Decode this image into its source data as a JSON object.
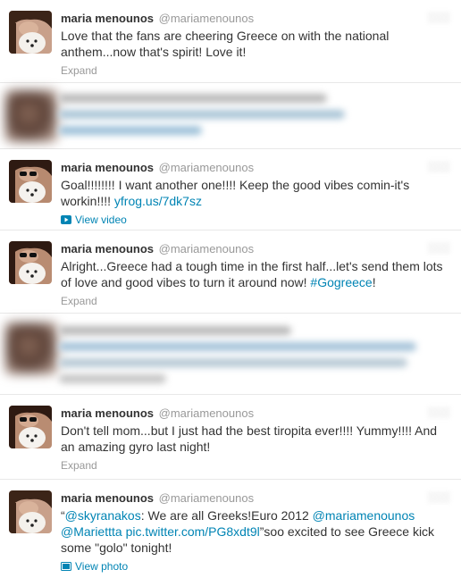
{
  "tweets": [
    {
      "fullname": "maria menounos",
      "username": "@mariamenounos",
      "text": "Love that the fans are cheering Greece on with the national anthem...now that's spirit! Love it!",
      "action": "Expand"
    },
    {
      "fullname": "maria menounos",
      "username": "@mariamenounos",
      "text_before": "Goal!!!!!!!! I want another one!!!! Keep the good vibes comin-it's workin!!!! ",
      "link": "yfrog.us/7dk7sz",
      "action": "View video",
      "action_icon": "video-icon"
    },
    {
      "fullname": "maria menounos",
      "username": "@mariamenounos",
      "text_before": "Alright...Greece had a tough time in the first half...let's send them lots of love and good vibes to turn it around now! ",
      "hashtag": "#Gogreece",
      "text_after": "!",
      "action": "Expand"
    },
    {
      "fullname": "maria menounos",
      "username": "@mariamenounos",
      "text": "Don't tell mom...but I just had the best tiropita ever!!!! Yummy!!!! And an amazing gyro last night!",
      "action": "Expand"
    },
    {
      "fullname": "maria menounos",
      "username": "@mariamenounos",
      "quote_open": "“",
      "mention1": "@skyranakos",
      "text_mid1": ": We are all Greeks!Euro 2012 ",
      "mention2": "@mariamenounos",
      "mention3": "@Mariettta",
      "link": "pic.twitter.com/PG8xdt9l",
      "text_after": "”soo excited to see Greece kick some \"golo\" tonight!",
      "action": "View photo",
      "action_icon": "photo-icon"
    }
  ],
  "colors": {
    "link": "#0084b4",
    "meta": "#999999",
    "text": "#333333",
    "divider": "#e8e8e8"
  }
}
